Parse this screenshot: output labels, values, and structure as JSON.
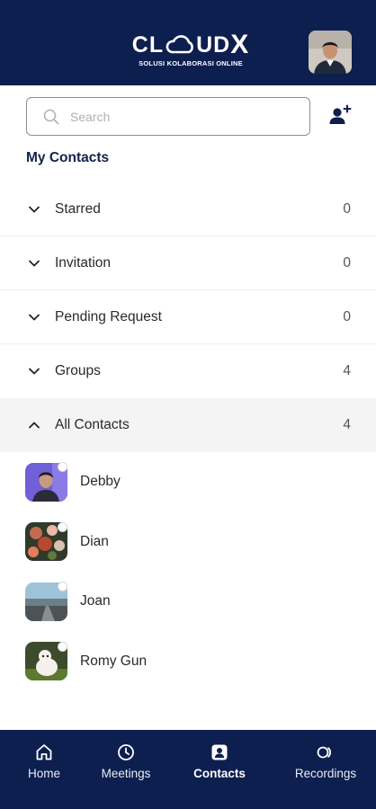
{
  "header": {
    "logo_text_left": "CL",
    "logo_text_right": "UD",
    "logo_text_x": "X",
    "tagline": "SOLUSI KOLABORASI ONLINE",
    "brand_color": "#0d1f4f"
  },
  "search": {
    "placeholder": "Search",
    "value": ""
  },
  "section": {
    "title": "My Contacts"
  },
  "groups": [
    {
      "label": "Starred",
      "count": "0",
      "expanded": false
    },
    {
      "label": "Invitation",
      "count": "0",
      "expanded": false
    },
    {
      "label": "Pending Request",
      "count": "0",
      "expanded": false
    },
    {
      "label": "Groups",
      "count": "4",
      "expanded": false
    },
    {
      "label": "All Contacts",
      "count": "4",
      "expanded": true
    }
  ],
  "contacts": [
    {
      "name": "Debby",
      "status": "offline"
    },
    {
      "name": "Dian",
      "status": "offline"
    },
    {
      "name": "Joan",
      "status": "offline"
    },
    {
      "name": "Romy Gun",
      "status": "offline"
    }
  ],
  "nav": {
    "items": [
      {
        "label": "Home",
        "icon": "home-icon",
        "active": false
      },
      {
        "label": "Meetings",
        "icon": "clock-icon",
        "active": false
      },
      {
        "label": "Contacts",
        "icon": "contact-card-icon",
        "active": true
      },
      {
        "label": "Recordings",
        "icon": "recording-icon",
        "active": false
      }
    ]
  }
}
